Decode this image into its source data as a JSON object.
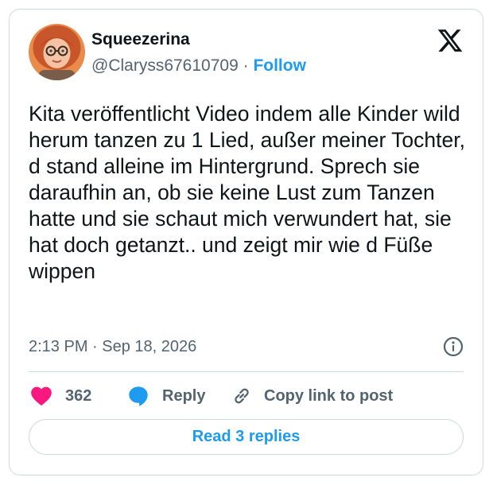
{
  "user": {
    "display_name": "Squeezerina",
    "handle": "@Claryss67610709",
    "separator": " · ",
    "follow_label": "Follow"
  },
  "tweet": {
    "text": "Kita veröffentlicht Video indem alle Kinder wild herum tanzen zu 1 Lied, außer meiner Tochter, d stand alleine im Hintergrund. Sprech sie daraufhin an, ob sie keine Lust zum Tanzen hatte und sie schaut mich verwundert hat, sie hat doch getanzt.. und zeigt mir wie d Füße wippen",
    "timestamp": "2:13 PM · Sep 18, 2026"
  },
  "actions": {
    "like_count": "362",
    "reply_label": "Reply",
    "copy_label": "Copy link to post"
  },
  "footer": {
    "read_replies_label": "Read 3 replies"
  },
  "icons": {
    "logo": "x-logo-icon",
    "info": "info-icon",
    "like": "heart-icon",
    "reply": "speech-bubble-icon",
    "copy": "link-icon"
  },
  "colors": {
    "accent": "#1d9bf0",
    "like": "#f91880",
    "text": "#0f1419",
    "secondary": "#536471",
    "border": "#cfd9de"
  }
}
